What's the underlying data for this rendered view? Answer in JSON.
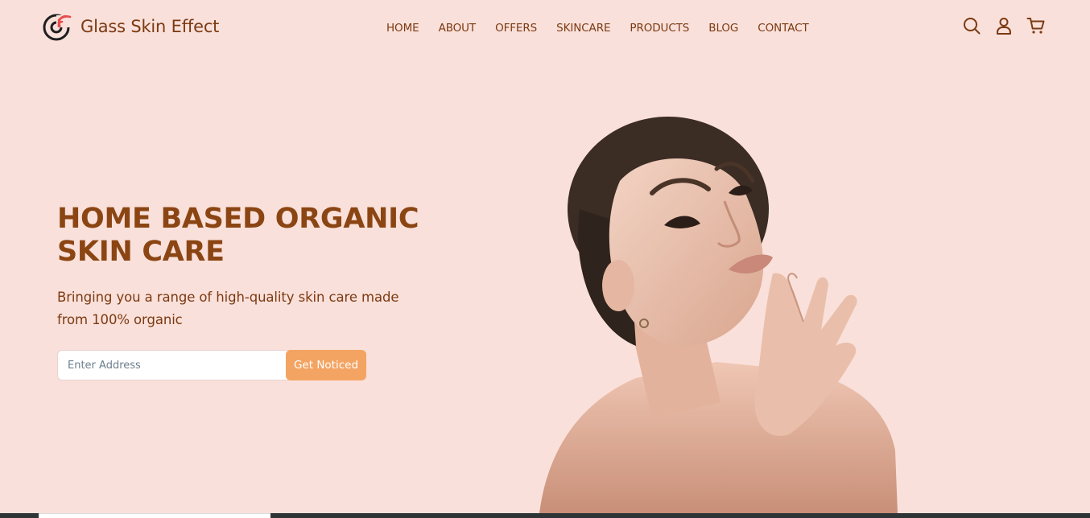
{
  "brand": {
    "name": "Glass Skin Effect",
    "logo_icon": "wifi-c-logo-icon",
    "accent_color": "#e74c4c"
  },
  "nav": {
    "items": [
      {
        "label": "HOME"
      },
      {
        "label": "ABOUT"
      },
      {
        "label": "OFFERS"
      },
      {
        "label": "SKINCARE"
      },
      {
        "label": "PRODUCTS"
      },
      {
        "label": "BLOG"
      },
      {
        "label": "CONTACT"
      }
    ],
    "icons": [
      "search-icon",
      "user-icon",
      "cart-icon"
    ]
  },
  "hero": {
    "title_line1": "HOME BASED ORGANIC",
    "title_line2": "SKIN CARE",
    "subtitle_line1": "Bringing you a range of high-quality skin care made",
    "subtitle_line2": "from 100% organic",
    "input_placeholder": "Enter Address",
    "button_label": "Get Noticed",
    "image": "woman-portrait"
  },
  "colors": {
    "background": "#fae0da",
    "text": "#7b3a12",
    "heading": "#8b4513",
    "button": "#f4a462"
  }
}
